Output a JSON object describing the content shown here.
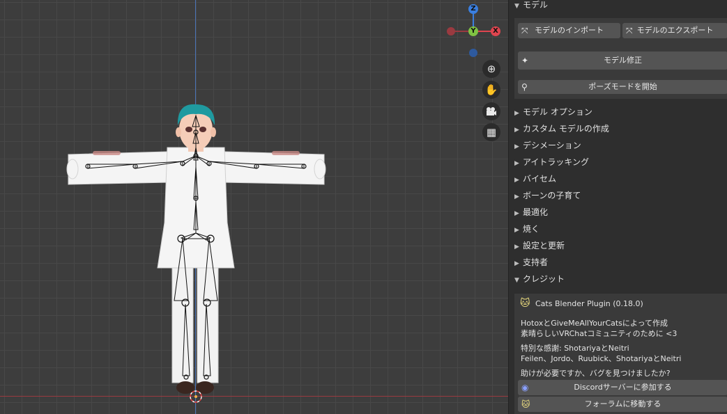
{
  "gizmo": {
    "z_label": "Z",
    "y_label": "Y",
    "x_label": "X"
  },
  "nav_icons": [
    "zoom-icon",
    "hand-icon",
    "camera-icon",
    "grid-icon"
  ],
  "sidebar": {
    "model_header": "モデル",
    "import_button": "モデルのインポート",
    "export_button": "モデルのエクスポート",
    "fix_button": "モデル修正",
    "pose_button": "ポーズモードを開始",
    "sections": [
      "モデル オプション",
      "カスタム モデルの作成",
      "デシメーション",
      "アイトラッキング",
      "バイセム",
      "ボーンの子育て",
      "最適化",
      "焼く",
      "設定と更新",
      "支持者"
    ],
    "credits_header": "クレジット",
    "plugin_name": "Cats Blender Plugin (0.18.0)",
    "credit_line1": "HotoxとGiveMeAllYourCatsによって作成",
    "credit_line2": "素晴らしいVRChatコミュニティのために <3",
    "thanks_line1": "特別な感謝: ShotariyaとNeitri",
    "thanks_line2": "Feilen、Jordo、Ruubick、ShotariyaとNeitri",
    "help_question": "助けが必要ですか、バグを見つけましたか?",
    "discord_button": "Discordサーバーに参加する",
    "forum_button": "フォーラムに移動する"
  },
  "colors": {
    "x_axis": "#e0454f",
    "y_axis": "#7fc243",
    "z_axis": "#3a7fe0",
    "hair": "#1f9aa0",
    "panel_bg": "#2e2e2e",
    "button_bg": "#545454"
  }
}
